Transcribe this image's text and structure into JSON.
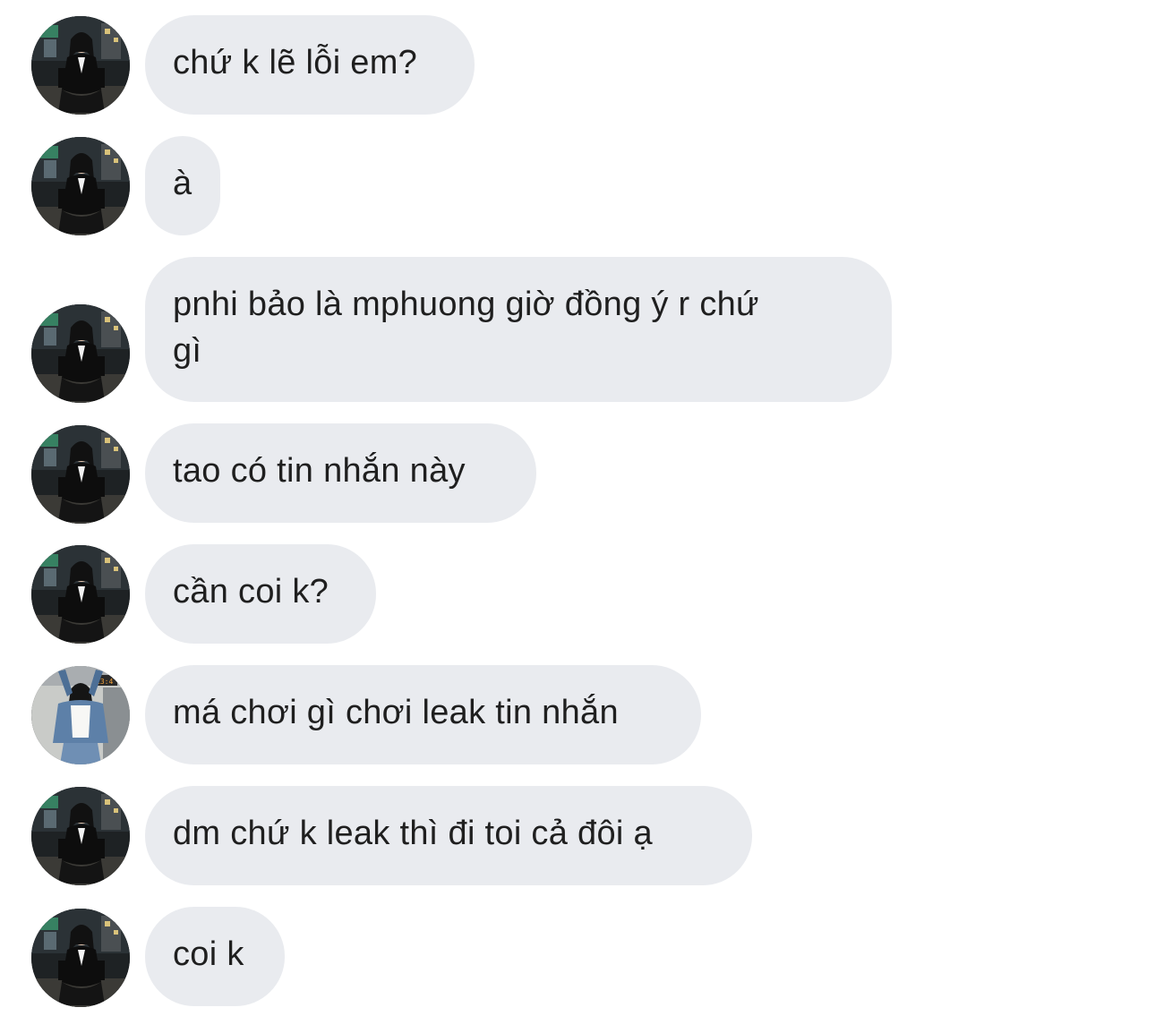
{
  "conversation": {
    "messages": [
      {
        "text": "chứ k lẽ lỗi em?",
        "sender": "friend_a"
      },
      {
        "text": "à",
        "sender": "friend_a"
      },
      {
        "text": "pnhi bảo là mphuong giờ đồng ý r chứ\ngì",
        "sender": "friend_a"
      },
      {
        "text": "tao có tin nhắn này",
        "sender": "friend_a"
      },
      {
        "text": "cần coi k?",
        "sender": "friend_a"
      },
      {
        "text": "má chơi gì chơi leak tin nhắn",
        "sender": "friend_b"
      },
      {
        "text": "dm chứ k leak thì đi toi cả đôi ạ",
        "sender": "friend_a"
      },
      {
        "text": "coi k",
        "sender": "friend_a"
      }
    ]
  },
  "colors": {
    "bubble_background": "#e9ebef",
    "text": "#1f1f1f",
    "page_background": "#ffffff"
  },
  "icons": {
    "friend_a_avatar": "avatar-photo-night-street-icon",
    "friend_b_avatar": "avatar-photo-denim-jacket-icon"
  }
}
